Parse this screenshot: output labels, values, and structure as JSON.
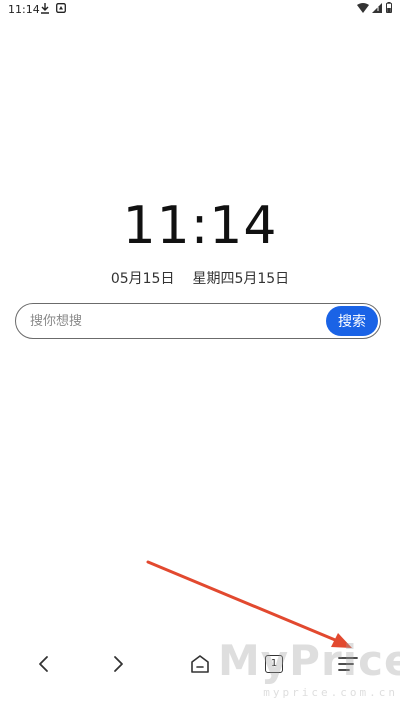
{
  "status_bar": {
    "time": "11:14",
    "icons": [
      "download-icon",
      "notification-icon",
      "wifi-icon",
      "signal-icon",
      "battery-icon"
    ]
  },
  "clock": {
    "time": "11:14",
    "date": "05月15日",
    "weekday_date": "星期四5月15日"
  },
  "search": {
    "placeholder": "搜你想搜",
    "value": "",
    "button_label": "搜索"
  },
  "bottom_nav": {
    "tab_count": "1",
    "icons": [
      "back-icon",
      "forward-icon",
      "home-icon",
      "tabs-icon",
      "menu-icon"
    ]
  },
  "annotation": {
    "type": "arrow",
    "color": "#e2492f",
    "points_to": "menu-button"
  },
  "watermark": {
    "main": "MyPrice",
    "sub": "myprice.com.cn"
  },
  "colors": {
    "accent": "#1a63e6",
    "arrow": "#e2492f"
  }
}
